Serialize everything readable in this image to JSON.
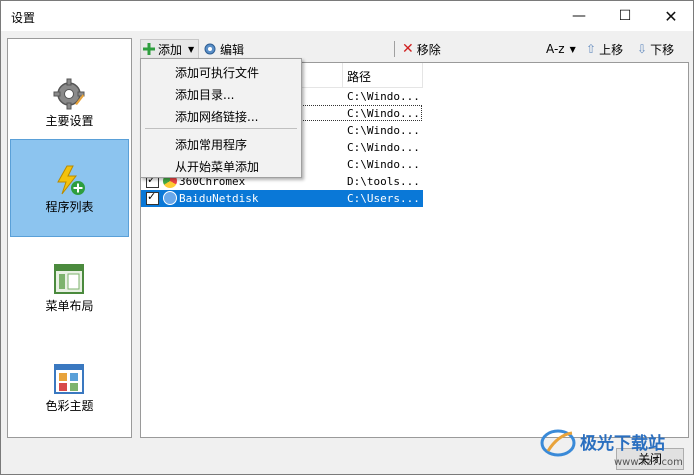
{
  "window": {
    "title": "设置"
  },
  "window_controls": {
    "minimize": "—",
    "maximize": "☐",
    "close": "✕"
  },
  "nav": {
    "items": [
      {
        "label": "主要设置",
        "icon": "gear-icon",
        "selected": false
      },
      {
        "label": "程序列表",
        "icon": "lightning-add-icon",
        "selected": true
      },
      {
        "label": "菜单布局",
        "icon": "layout-icon",
        "selected": false
      },
      {
        "label": "色彩主题",
        "icon": "palette-icon",
        "selected": false
      }
    ]
  },
  "toolbar": {
    "add": "添加",
    "edit": "编辑",
    "remove": "移除",
    "sort": "A-z",
    "move_up": "上移",
    "move_down": "下移"
  },
  "list": {
    "columns": [
      "路径"
    ],
    "rows": [
      {
        "name": "",
        "path": "C:\\Windo...",
        "checked": true
      },
      {
        "name": "",
        "path": "C:\\Windo...",
        "checked": true
      },
      {
        "name": "",
        "path": "C:\\Windo...",
        "checked": true
      },
      {
        "name": "",
        "path": "C:\\Windo...",
        "checked": true
      },
      {
        "name": "",
        "path": "C:\\Windo...",
        "checked": true
      },
      {
        "name": "360Chromex",
        "path": "D:\\tools...",
        "checked": true
      },
      {
        "name": "BaiduNetdisk",
        "path": "C:\\Users...",
        "checked": true,
        "selected": true
      }
    ]
  },
  "add_menu": {
    "items": [
      "添加可执行文件",
      "添加目录...",
      "添加网络链接...",
      "添加常用程序",
      "从开始菜单添加"
    ]
  },
  "footer": {
    "close": "关闭"
  },
  "watermark": {
    "text": "极光下载站",
    "url": "www.xz7.com"
  },
  "colors": {
    "selection": "#0a78d7",
    "nav_selected": "#8cc4ef"
  }
}
